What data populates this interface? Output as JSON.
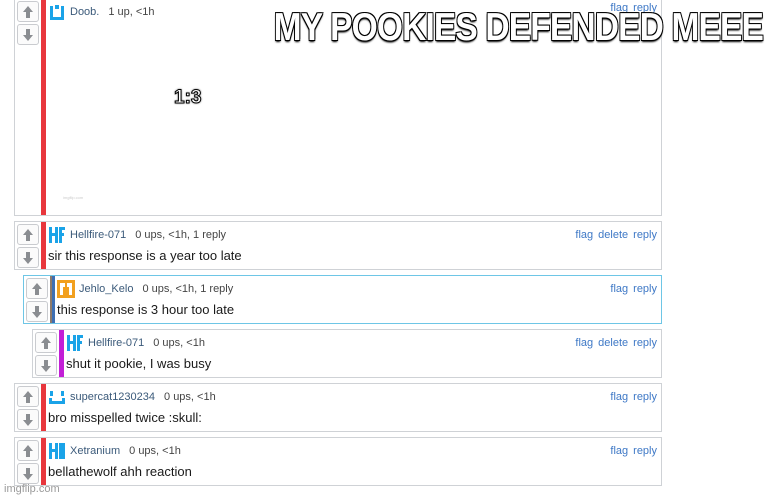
{
  "caption": "MY POOKIES DEFENDED MEEE",
  "watermark": "imgflip.com",
  "top_comment": {
    "username": "Doob.",
    "stats": "1 up, <1h",
    "embed_text": "1:3",
    "embed_watermark": "imgflip.com",
    "actions": [
      "flag",
      "reply"
    ]
  },
  "comments": [
    {
      "username": "Hellfire-071",
      "stats": "0 ups, <1h, 1 reply",
      "text": "sir this response is a year too late",
      "actions": [
        "flag",
        "delete",
        "reply"
      ]
    },
    {
      "username": "Jehlo_Kelo",
      "stats": "0 ups, <1h, 1 reply",
      "text": "this response is 3 hour too late",
      "actions": [
        "flag",
        "reply"
      ]
    },
    {
      "username": "Hellfire-071",
      "stats": "0 ups, <1h",
      "text": "shut it pookie, I was busy",
      "actions": [
        "flag",
        "delete",
        "reply"
      ]
    },
    {
      "username": "supercat1230234",
      "stats": "0 ups, <1h",
      "text": "bro misspelled twice :skull:",
      "actions": [
        "flag",
        "reply"
      ]
    },
    {
      "username": "Xetranium",
      "stats": "0 ups, <1h",
      "text": "bellathewolf ahh reaction",
      "actions": [
        "flag",
        "reply"
      ]
    }
  ],
  "icons": {
    "upvote": "arrow-up-icon",
    "downvote": "arrow-down-icon"
  },
  "colors": {
    "thread_bar": "#e8373d",
    "nested_bar": "#c21fd6",
    "link": "#3e78c6",
    "username": "#3b5a7a"
  }
}
